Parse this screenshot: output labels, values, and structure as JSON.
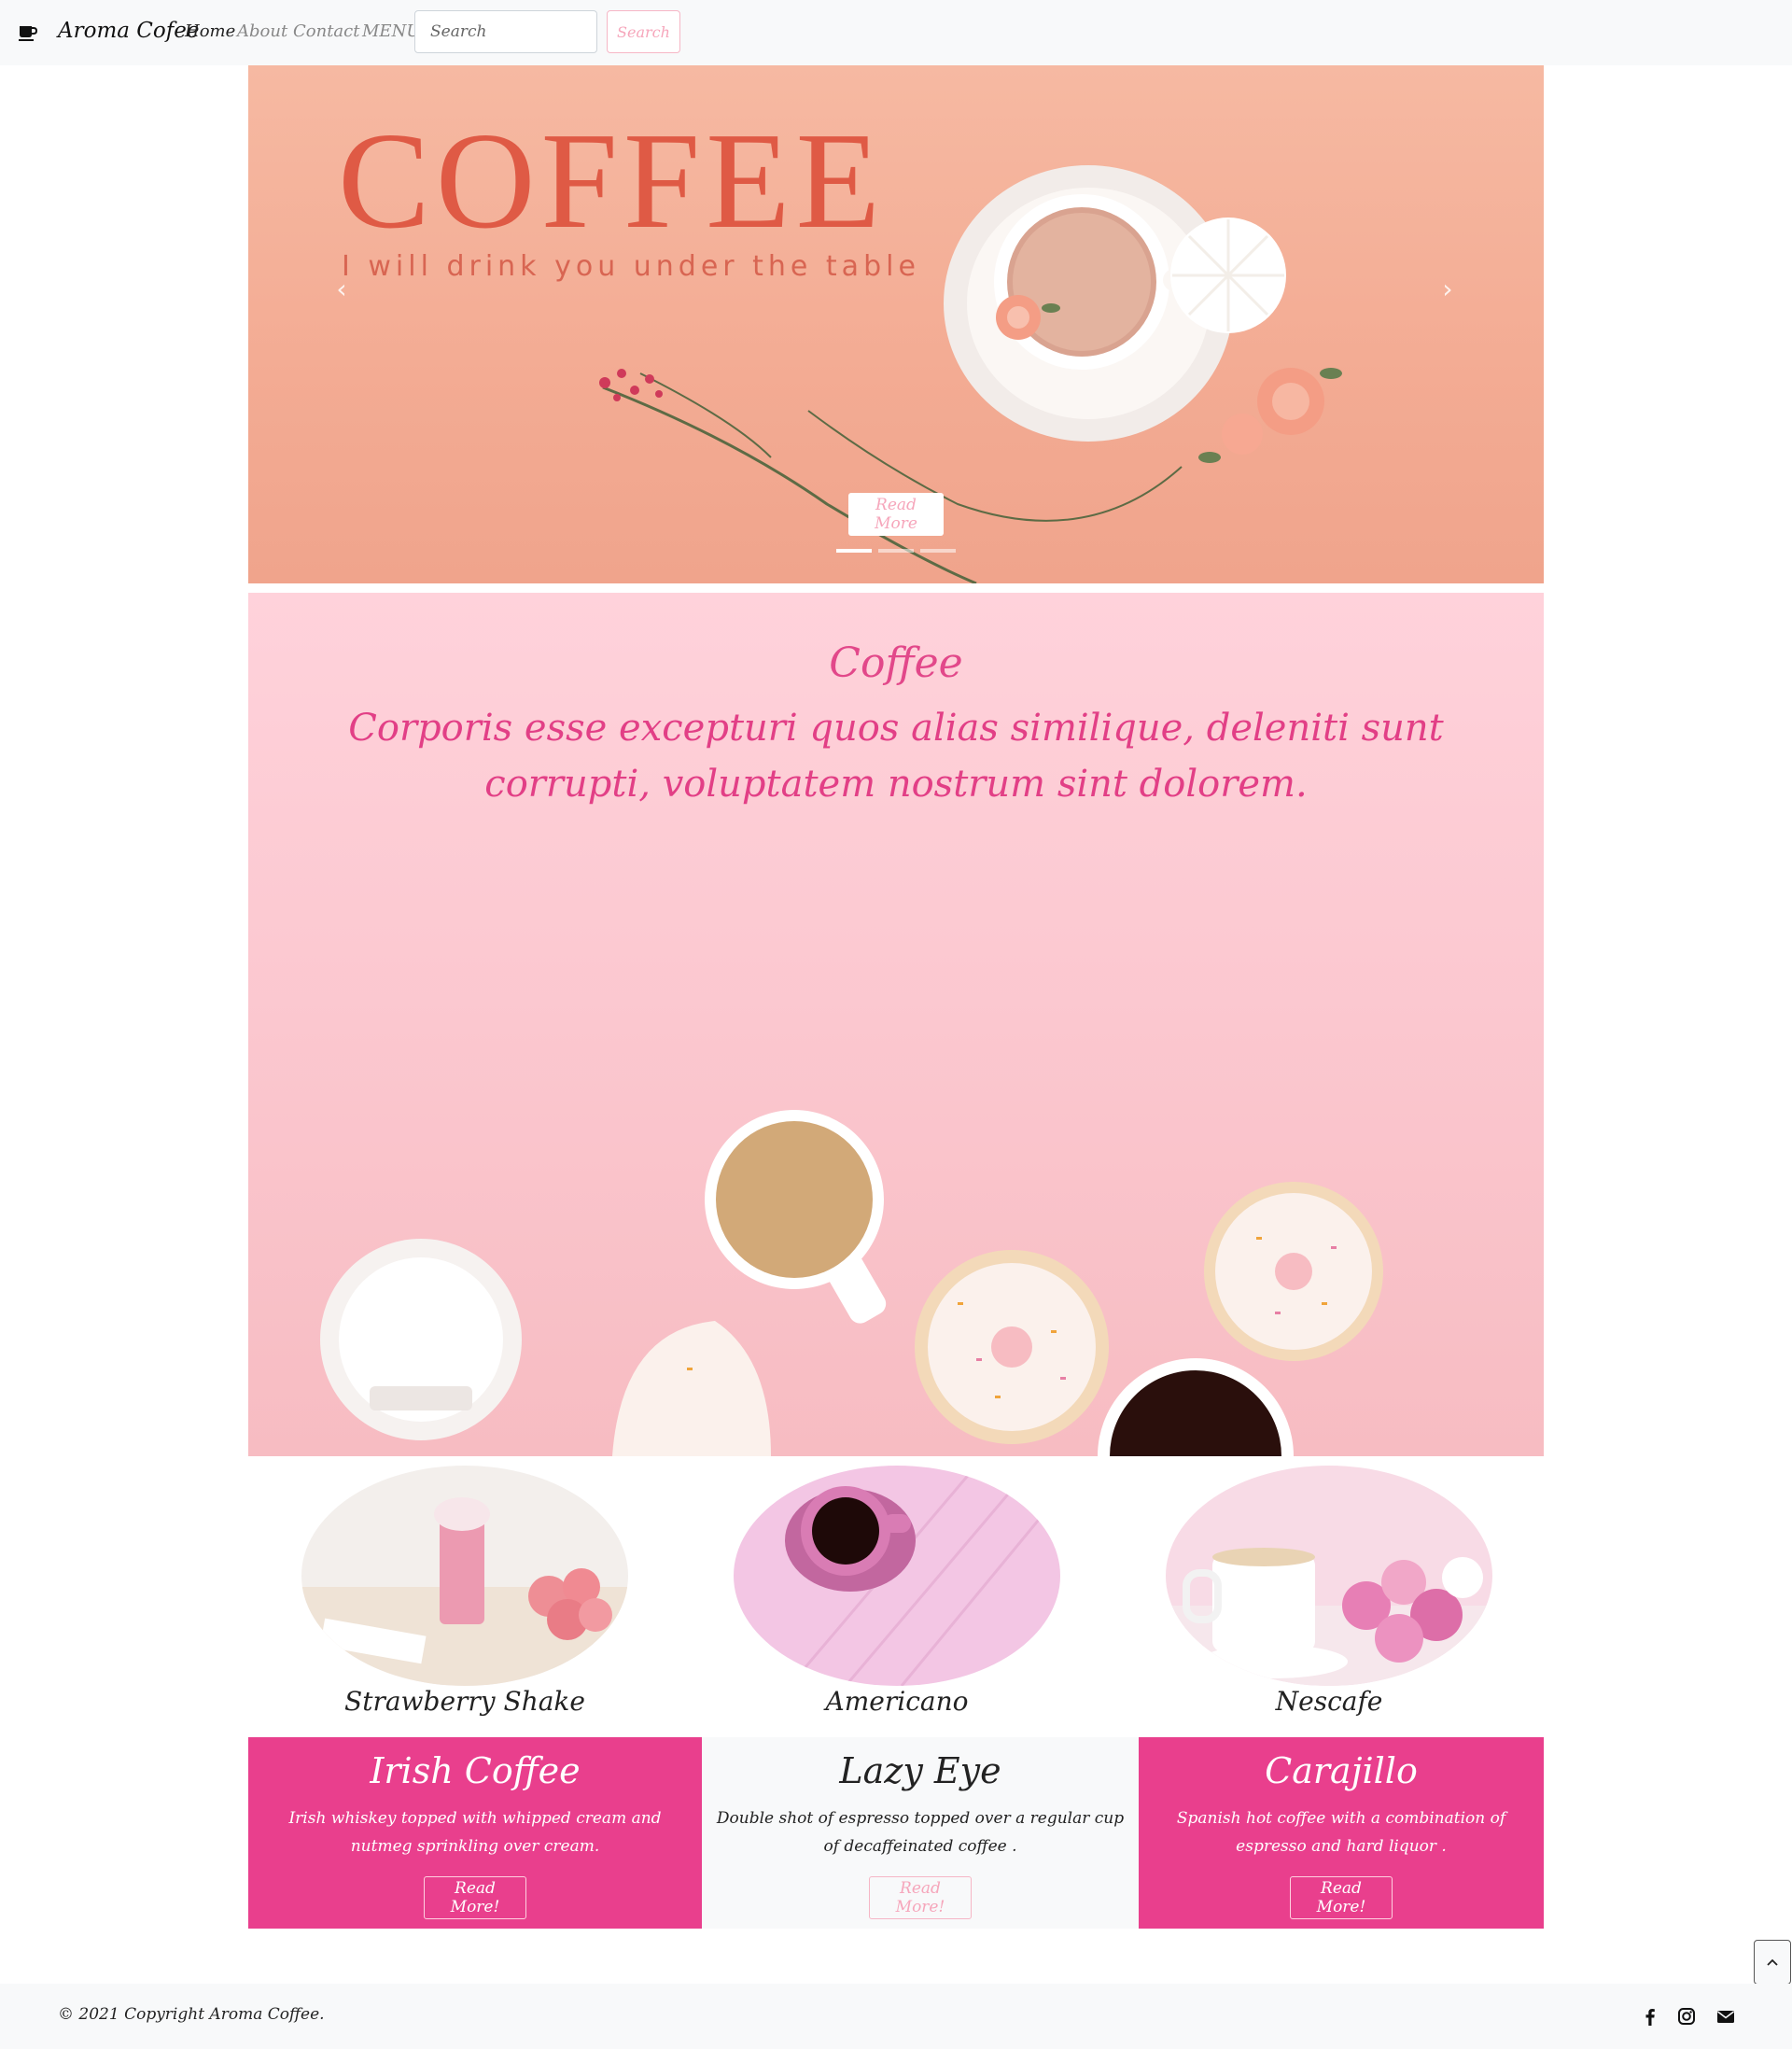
{
  "navbar": {
    "brand": "Aroma Cofee",
    "brand_icon": "coffee-cup-icon",
    "links": [
      "Home",
      "About",
      "Contact",
      "MENU"
    ],
    "search_placeholder": "Search",
    "search_button": "Search"
  },
  "hero": {
    "title": "COFFEE",
    "subtitle": "I will drink you under the table",
    "read_more": "Read More",
    "slides": 3,
    "active_slide": 1
  },
  "banner": {
    "title": "Coffee",
    "text": "Corporis esse excepturi quos alias similique, deleniti sunt corrupti, voluptatem nostrum sint dolorem."
  },
  "products": [
    {
      "name": "Strawberry Shake"
    },
    {
      "name": "Americano"
    },
    {
      "name": "Nescafe"
    }
  ],
  "cards": [
    {
      "title": "Irish Coffee",
      "description": "Irish whiskey topped with whipped cream and nutmeg sprinkling over cream.",
      "button": "Read More!"
    },
    {
      "title": "Lazy Eye",
      "description": "Double shot of espresso topped over a regular cup of decaffeinated coffee .",
      "button": "Read More!"
    },
    {
      "title": "Carajillo",
      "description": "Spanish hot coffee with a combination of espresso and hard liquor .",
      "button": "Read More!"
    }
  ],
  "footer": {
    "copyright": "© 2021 Copyright Aroma Coffee.",
    "social_icons": [
      "facebook-icon",
      "instagram-icon",
      "envelope-icon"
    ]
  },
  "colors": {
    "accent_pink": "#e93f8d",
    "hero_peach": "#f3ab93",
    "hero_title": "#df5a45",
    "banner_pink": "#fbc7cf",
    "navbar_bg": "#f8f9fa"
  }
}
